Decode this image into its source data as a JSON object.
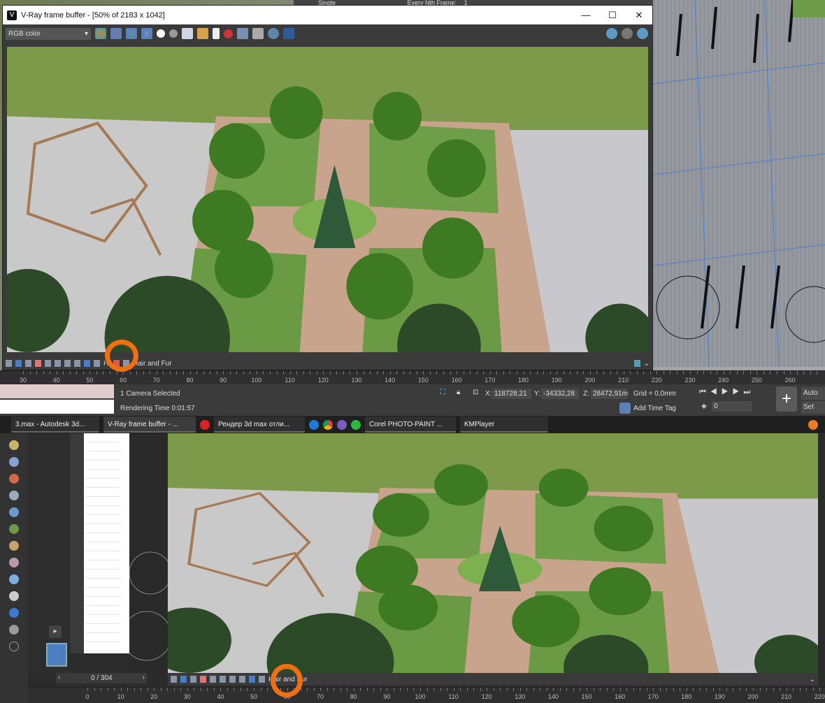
{
  "background_viewport": {
    "render_setup_label": "Single",
    "every_nth_frame_label": "Every Nth Frame:",
    "every_nth_frame_value": "1"
  },
  "vfb": {
    "title": "V-Ray frame buffer - [50% of 2183 x 1042]",
    "channel_select": "RGB color",
    "toolbar_buttons": [
      "R",
      "G",
      "B"
    ],
    "bottom_label": "Hair and Fur"
  },
  "timeline_top": {
    "ticks": [
      30,
      40,
      50,
      60,
      70,
      80,
      90,
      100,
      110,
      120,
      130,
      140,
      150,
      160,
      170,
      180,
      190,
      200,
      210,
      220,
      230,
      240,
      250,
      260
    ]
  },
  "status": {
    "selection": "1 Camera Selected",
    "rendering_time": "Rendering Time  0:01:57",
    "x_label": "X:",
    "x_value": "118728,21",
    "y_label": "Y:",
    "y_value": "-34332,28",
    "z_label": "Z:",
    "z_value": "28472,91m",
    "grid": "Grid = 0,0mm",
    "add_time_tag": "Add Time Tag",
    "frame_value": "0",
    "auto_key": "Auto Key",
    "set_key": "Set Key"
  },
  "taskbar": {
    "items": [
      "3.max - Autodesk 3d...",
      "V-Ray frame buffer - ...",
      "Рендер 3d max отли...",
      "Corel PHOTO-PAINT ...",
      "KMPlayer"
    ]
  },
  "bottom": {
    "frame_counter": "0 / 304",
    "vfb_bottom_label": "Hair and Fur",
    "ticks": [
      0,
      10,
      20,
      30,
      40,
      50,
      60,
      70,
      80,
      90,
      100,
      110,
      120,
      130,
      140,
      150,
      160,
      170,
      180,
      190,
      200,
      210,
      220
    ]
  },
  "colors": {
    "highlight_circle": "#f07010",
    "vfb_bg": "#3a3a3a"
  }
}
